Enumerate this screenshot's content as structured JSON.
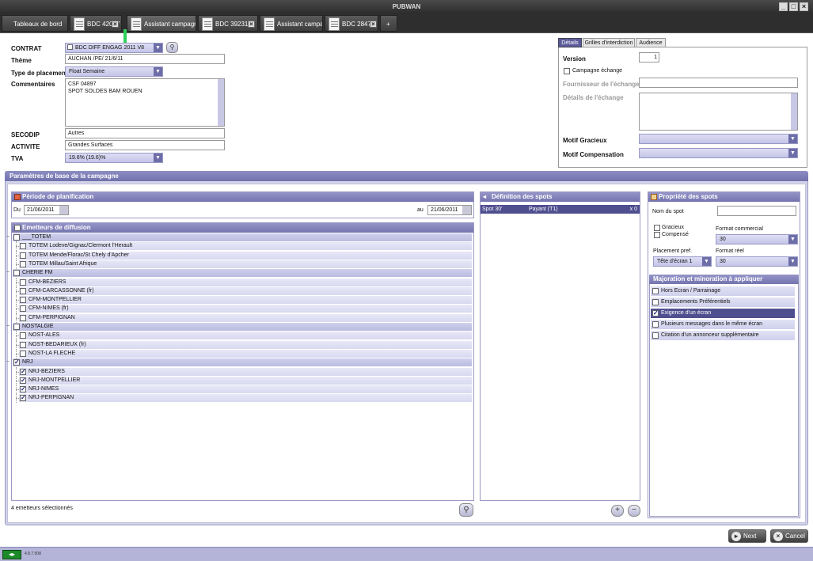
{
  "window": {
    "title": "PUBWAN"
  },
  "tabs": [
    {
      "label": "Tableaux de bord"
    },
    {
      "label": "BDC 42057"
    },
    {
      "label": "Assistant campagne"
    },
    {
      "label": "BDC 39231"
    },
    {
      "label": "Assistant campagne"
    },
    {
      "label": "BDC 28475"
    },
    {
      "label": "+"
    }
  ],
  "form": {
    "contrat_label": "CONTRAT",
    "contrat_value": "BDC DIFF ENGAG 2011 V8",
    "theme_label": "Thème",
    "theme_value": "AUCHAN /PE/ 21/6/11",
    "type_label": "Type de placement",
    "type_value": "Float Semaine",
    "comments_label": "Commentaires",
    "comments_line1": "CSF 04897",
    "comments_line2": "SPOT SOLDES BAM ROUEN",
    "secodip_label": "SECODIP",
    "secodip_value": "Autres",
    "activite_label": "ACTIVITE",
    "activite_value": "Grandes Surfaces",
    "tva_label": "TVA",
    "tva_value": "19.6% (19.6)%"
  },
  "details": {
    "tabs": [
      "Détails",
      "Grilles d'interdiction",
      "Audience"
    ],
    "version_label": "Version",
    "version_value": "1",
    "campagne_echange": "Campagne échange",
    "fournisseur_label": "Fournisseur de l'échange",
    "details_echange_label": "Détails de l'échange",
    "motif_gracieux_label": "Motif Gracieux",
    "motif_compensation_label": "Motif Compensation"
  },
  "campaign": {
    "title": "Paramètres de base de la campagne",
    "periode_title": "Période de planification",
    "du_label": "Du",
    "du_value": "21/06/2011",
    "au_label": "au",
    "au_value": "21/06/2011",
    "emetteurs_title": "Emetteurs de diffusion",
    "selected_count": "4 emetteurs sélectionnés"
  },
  "tree": [
    {
      "type": "group",
      "label": "___TOTEM",
      "checked": false
    },
    {
      "type": "item",
      "label": "TOTEM Lodeve/Gignac/Clermont l'Herault",
      "checked": false
    },
    {
      "type": "item",
      "label": "TOTEM Mende/Florac/St Chely d'Apcher",
      "checked": false
    },
    {
      "type": "item",
      "label": "TOTEM Millau/Saint Afrique",
      "checked": false
    },
    {
      "type": "group",
      "label": "CHERIE FM",
      "checked": false
    },
    {
      "type": "item",
      "label": "CFM-BEZIERS",
      "checked": false
    },
    {
      "type": "item",
      "label": "CFM-CARCASSONNE (fr)",
      "checked": false
    },
    {
      "type": "item",
      "label": "CFM-MONTPELLIER",
      "checked": false
    },
    {
      "type": "item",
      "label": "CFM-NIMES (fr)",
      "checked": false
    },
    {
      "type": "item",
      "label": "CFM-PERPIGNAN",
      "checked": false
    },
    {
      "type": "group",
      "label": "NOSTALGIE",
      "checked": false
    },
    {
      "type": "item",
      "label": "NOST-ALES",
      "checked": false
    },
    {
      "type": "item",
      "label": "NOST-BEDARIEUX (fr)",
      "checked": false
    },
    {
      "type": "item",
      "label": "NOST-LA FLECHE",
      "checked": false
    },
    {
      "type": "group",
      "label": "NRJ",
      "checked": true
    },
    {
      "type": "item",
      "label": "NRJ-BEZIERS",
      "checked": true
    },
    {
      "type": "item",
      "label": "NRJ-MONTPELLIER",
      "checked": true
    },
    {
      "type": "item",
      "label": "NRJ-NIMES",
      "checked": true
    },
    {
      "type": "item",
      "label": "NRJ-PERPIGNAN",
      "checked": true
    }
  ],
  "spots": {
    "title": "Définition des spots",
    "row": {
      "name": "Spot 30'",
      "type": "Payant (T1)",
      "count": "x 0"
    }
  },
  "props": {
    "title": "Propriété des spots",
    "nom_label": "Nom du spot",
    "gracieux": "Gracieux",
    "compense": "Compensé",
    "format_commercial_label": "Format commercial",
    "format_commercial_value": "30",
    "placement_label": "Placement pref.",
    "placement_value": "Tête d'écran 1",
    "format_reel_label": "Format réel",
    "format_reel_value": "30",
    "majoration_title": "Majoration et minoration à appliquer",
    "majorations": [
      {
        "label": "Hors Ecran / Parrainage",
        "checked": false
      },
      {
        "label": "Emplacements Préférentiels",
        "checked": false
      },
      {
        "label": "Exigence d'un écran",
        "checked": true
      },
      {
        "label": "Plusieurs messages dans le même écran",
        "checked": false
      },
      {
        "label": "Citation d'un annonceur supplémentaire",
        "checked": false
      }
    ]
  },
  "buttons": {
    "next": "Next",
    "cancel": "Cancel"
  },
  "status": {
    "version": "4.8.7.508"
  },
  "colors": {
    "accent": "#7575b0",
    "selected": "#4f4f90",
    "titlebar": "#2b2b2b"
  }
}
